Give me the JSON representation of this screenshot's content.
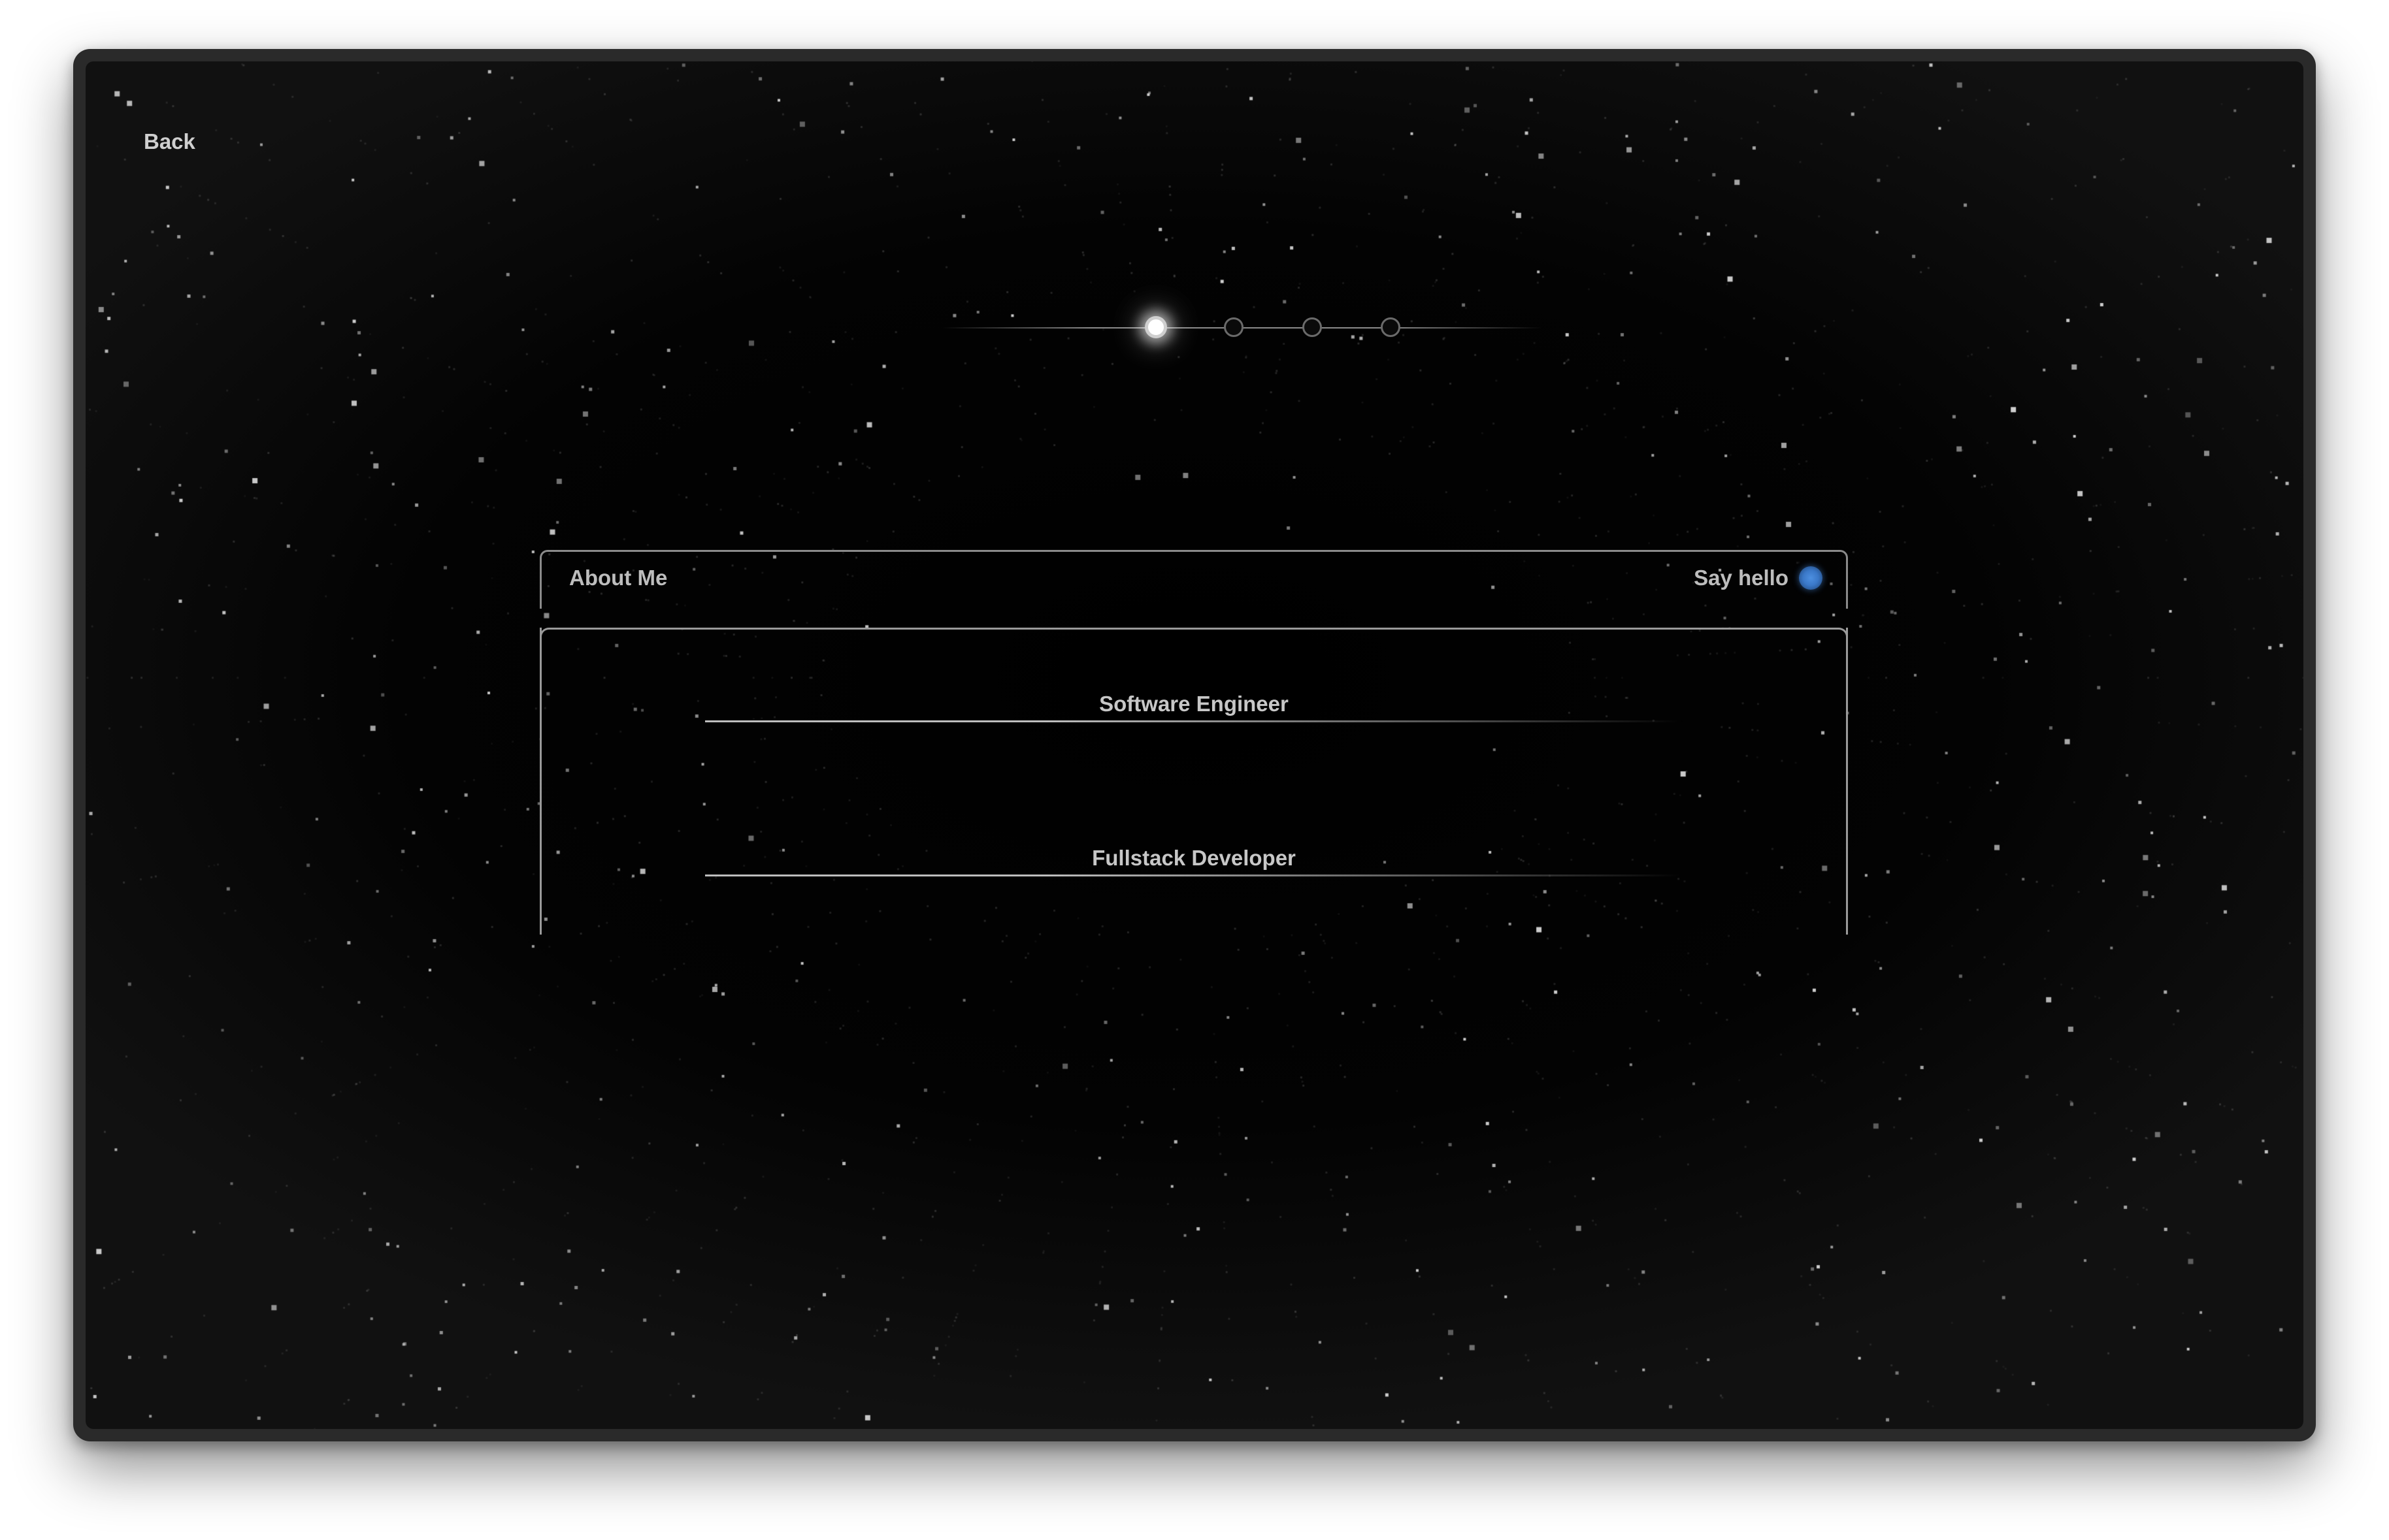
{
  "nav": {
    "back_label": "Back"
  },
  "stepper": {
    "steps": 4,
    "active_index": 0
  },
  "header": {
    "title": "About Me",
    "cta_label": "Say hello",
    "status_color": "#3a78c8"
  },
  "roles": [
    "Software Engineer",
    "Fullstack Developer"
  ],
  "colors": {
    "background": "#000000",
    "accent": "#3a78c8",
    "text": "#c7c7c7"
  }
}
